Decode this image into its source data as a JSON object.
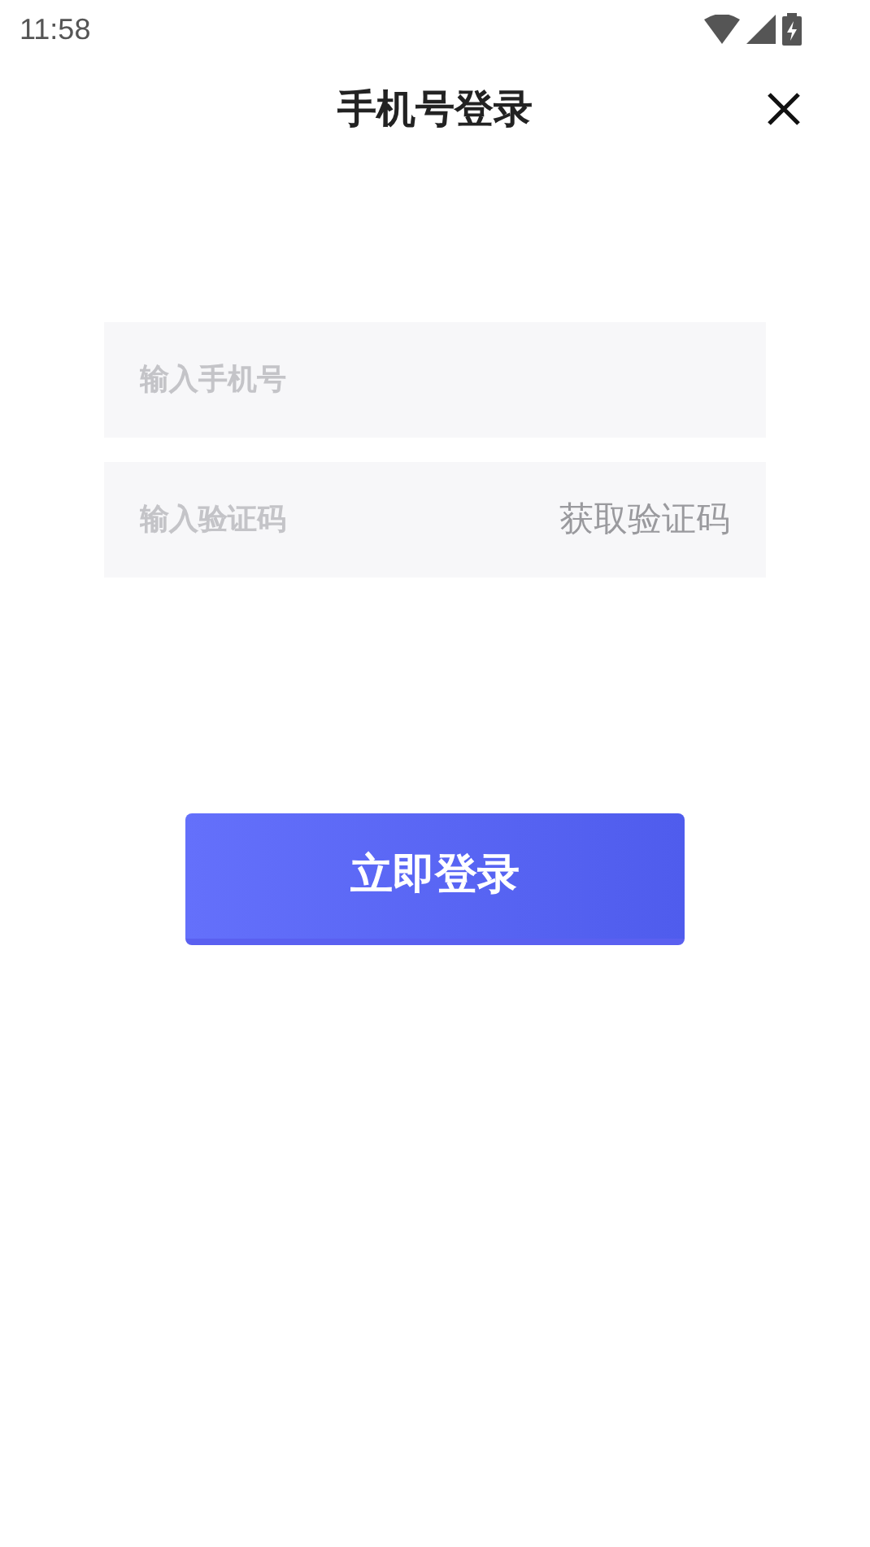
{
  "status_bar": {
    "time": "11:58"
  },
  "header": {
    "title": "手机号登录"
  },
  "form": {
    "phone": {
      "placeholder": "输入手机号"
    },
    "code": {
      "placeholder": "输入验证码",
      "action": "获取验证码"
    },
    "submit": "立即登录"
  }
}
